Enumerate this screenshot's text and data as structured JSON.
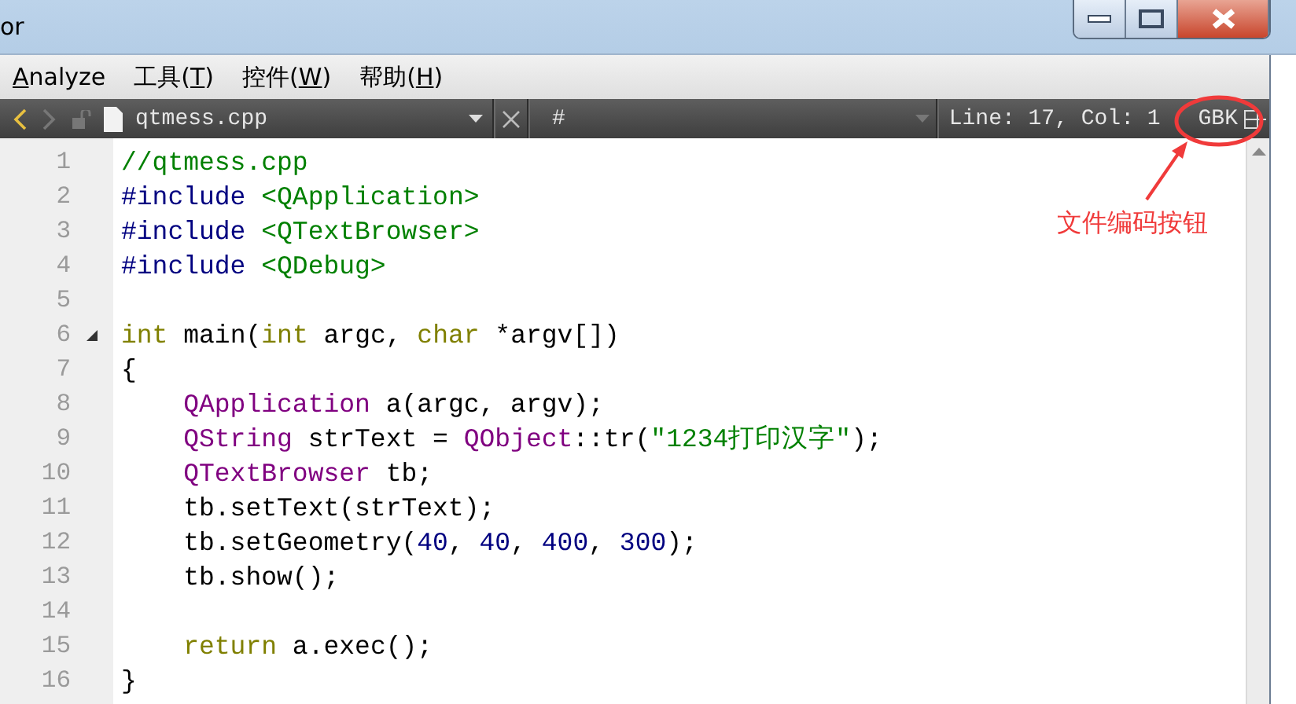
{
  "window": {
    "title": "or"
  },
  "menu": [
    {
      "key": "A",
      "after": "nalyze"
    },
    {
      "before": "工具(",
      "key": "T",
      "after": ")"
    },
    {
      "before": "控件(",
      "key": "W",
      "after": ")"
    },
    {
      "before": "帮助(",
      "key": "H",
      "after": ")"
    }
  ],
  "editor_toolbar": {
    "back_disabled": false,
    "forward_disabled": true,
    "file_name": "qtmess.cpp",
    "symbol": "#",
    "position": "Line: 17, Col: 1",
    "encoding": "GBK"
  },
  "code_lines": [
    {
      "number": "1",
      "tokens": [
        {
          "t": "//qtmess.cpp",
          "kind": "comment"
        }
      ]
    },
    {
      "number": "2",
      "tokens": [
        {
          "t": "#include ",
          "kind": "preproc"
        },
        {
          "t": "<QApplication>",
          "kind": "string"
        }
      ]
    },
    {
      "number": "3",
      "tokens": [
        {
          "t": "#include ",
          "kind": "preproc"
        },
        {
          "t": "<QTextBrowser>",
          "kind": "string"
        }
      ]
    },
    {
      "number": "4",
      "tokens": [
        {
          "t": "#include ",
          "kind": "preproc"
        },
        {
          "t": "<QDebug>",
          "kind": "string"
        }
      ]
    },
    {
      "number": "5"
    },
    {
      "number": "6",
      "fold": true,
      "tokens": [
        {
          "t": "int",
          "kind": "keyword"
        },
        {
          "t": " main(",
          "kind": "plain"
        },
        {
          "t": "int",
          "kind": "keyword"
        },
        {
          "t": " argc, ",
          "kind": "plain"
        },
        {
          "t": "char",
          "kind": "keyword"
        },
        {
          "t": " *argv[])",
          "kind": "plain"
        }
      ]
    },
    {
      "number": "7",
      "tokens": [
        {
          "t": "{",
          "kind": "plain"
        }
      ]
    },
    {
      "number": "8",
      "tokens": [
        {
          "t": "    QApplication",
          "kind": "type"
        },
        {
          "t": " a(argc, argv);",
          "kind": "plain"
        }
      ]
    },
    {
      "number": "9",
      "tokens": [
        {
          "t": "    QString",
          "kind": "type"
        },
        {
          "t": " strText = ",
          "kind": "plain"
        },
        {
          "t": "QObject",
          "kind": "type"
        },
        {
          "t": "::tr(",
          "kind": "plain"
        },
        {
          "t": "\"1234打印汉字\"",
          "kind": "string"
        },
        {
          "t": ");",
          "kind": "plain"
        }
      ]
    },
    {
      "number": "10",
      "tokens": [
        {
          "t": "    QTextBrowser",
          "kind": "type"
        },
        {
          "t": " tb;",
          "kind": "plain"
        }
      ]
    },
    {
      "number": "11",
      "tokens": [
        {
          "t": "    tb.setText(strText);",
          "kind": "plain"
        }
      ]
    },
    {
      "number": "12",
      "tokens": [
        {
          "t": "    tb.setGeometry(",
          "kind": "plain"
        },
        {
          "t": "40",
          "kind": "number"
        },
        {
          "t": ", ",
          "kind": "plain"
        },
        {
          "t": "40",
          "kind": "number"
        },
        {
          "t": ", ",
          "kind": "plain"
        },
        {
          "t": "400",
          "kind": "number"
        },
        {
          "t": ", ",
          "kind": "plain"
        },
        {
          "t": "300",
          "kind": "number"
        },
        {
          "t": ");",
          "kind": "plain"
        }
      ]
    },
    {
      "number": "13",
      "tokens": [
        {
          "t": "    tb.show();",
          "kind": "plain"
        }
      ]
    },
    {
      "number": "14"
    },
    {
      "number": "15",
      "tokens": [
        {
          "t": "    return",
          "kind": "keyword"
        },
        {
          "t": " a.exec();",
          "kind": "plain"
        }
      ]
    },
    {
      "number": "16",
      "tokens": [
        {
          "t": "}",
          "kind": "plain"
        }
      ]
    }
  ],
  "annotation": {
    "text": "文件编码按钮",
    "color": "#f03a3a"
  }
}
